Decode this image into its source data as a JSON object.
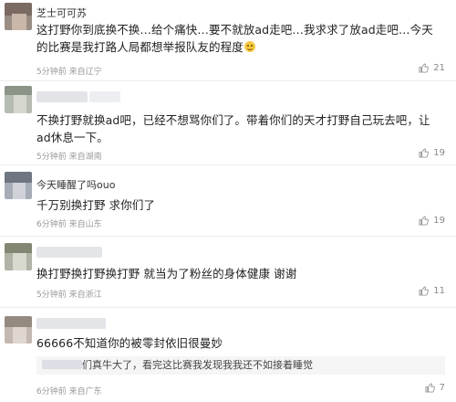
{
  "comments": [
    {
      "username": "芝士可可苏",
      "text_before_emoji": "这打野你到底换不换…给个痛快…要不就放ad走吧…我求求了放ad走吧…今天的比赛是我打路人局都想举报队友的程度",
      "emoji_icon": "grin-emoji-icon",
      "meta": "5分钟前 来自辽宁",
      "likes": "21"
    },
    {
      "username": "",
      "text": "不换打野就换ad吧，已经不想骂你们了。带着你们的天才打野自己玩去吧，让ad休息一下。",
      "meta": "5分钟前 来自湖南",
      "likes": "19"
    },
    {
      "username": "今天睡醒了吗ouo",
      "text": "千万别换打野 求你们了",
      "meta": "6分钟前 来自山东",
      "likes": "19"
    },
    {
      "username": "",
      "text": "换打野换打野换打野 就当为了粉丝的身体健康 谢谢",
      "meta": "5分钟前 来自浙江",
      "likes": "11"
    },
    {
      "username": "",
      "text": "66666不知道你的被零封依旧很曼妙",
      "reply": "们真牛大了，看完这比赛我发现我我还不如接着睡觉",
      "meta": "6分钟前 来自广东",
      "likes": "7"
    }
  ],
  "colors": {
    "text": "#222222",
    "meta": "#999999",
    "separator": "#ececec",
    "reply_bg": "#f5f5f5"
  },
  "icons": {
    "like": "thumbs-up-icon",
    "avatar": "avatar"
  }
}
